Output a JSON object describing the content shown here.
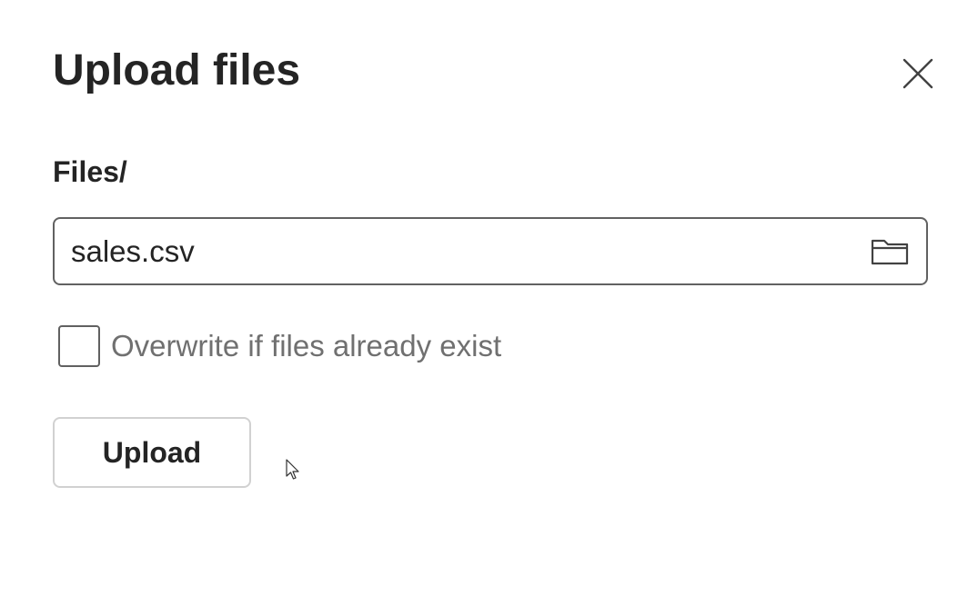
{
  "dialog": {
    "title": "Upload files",
    "close_icon": "close-icon"
  },
  "field": {
    "label": "Files/",
    "value": "sales.csv",
    "browse_icon": "folder-icon"
  },
  "overwrite": {
    "label": "Overwrite if files already exist",
    "checked": false
  },
  "actions": {
    "upload_label": "Upload"
  },
  "colors": {
    "text": "#242424",
    "border": "#616161",
    "muted_text": "#707070",
    "button_border": "#d1d1d1"
  }
}
